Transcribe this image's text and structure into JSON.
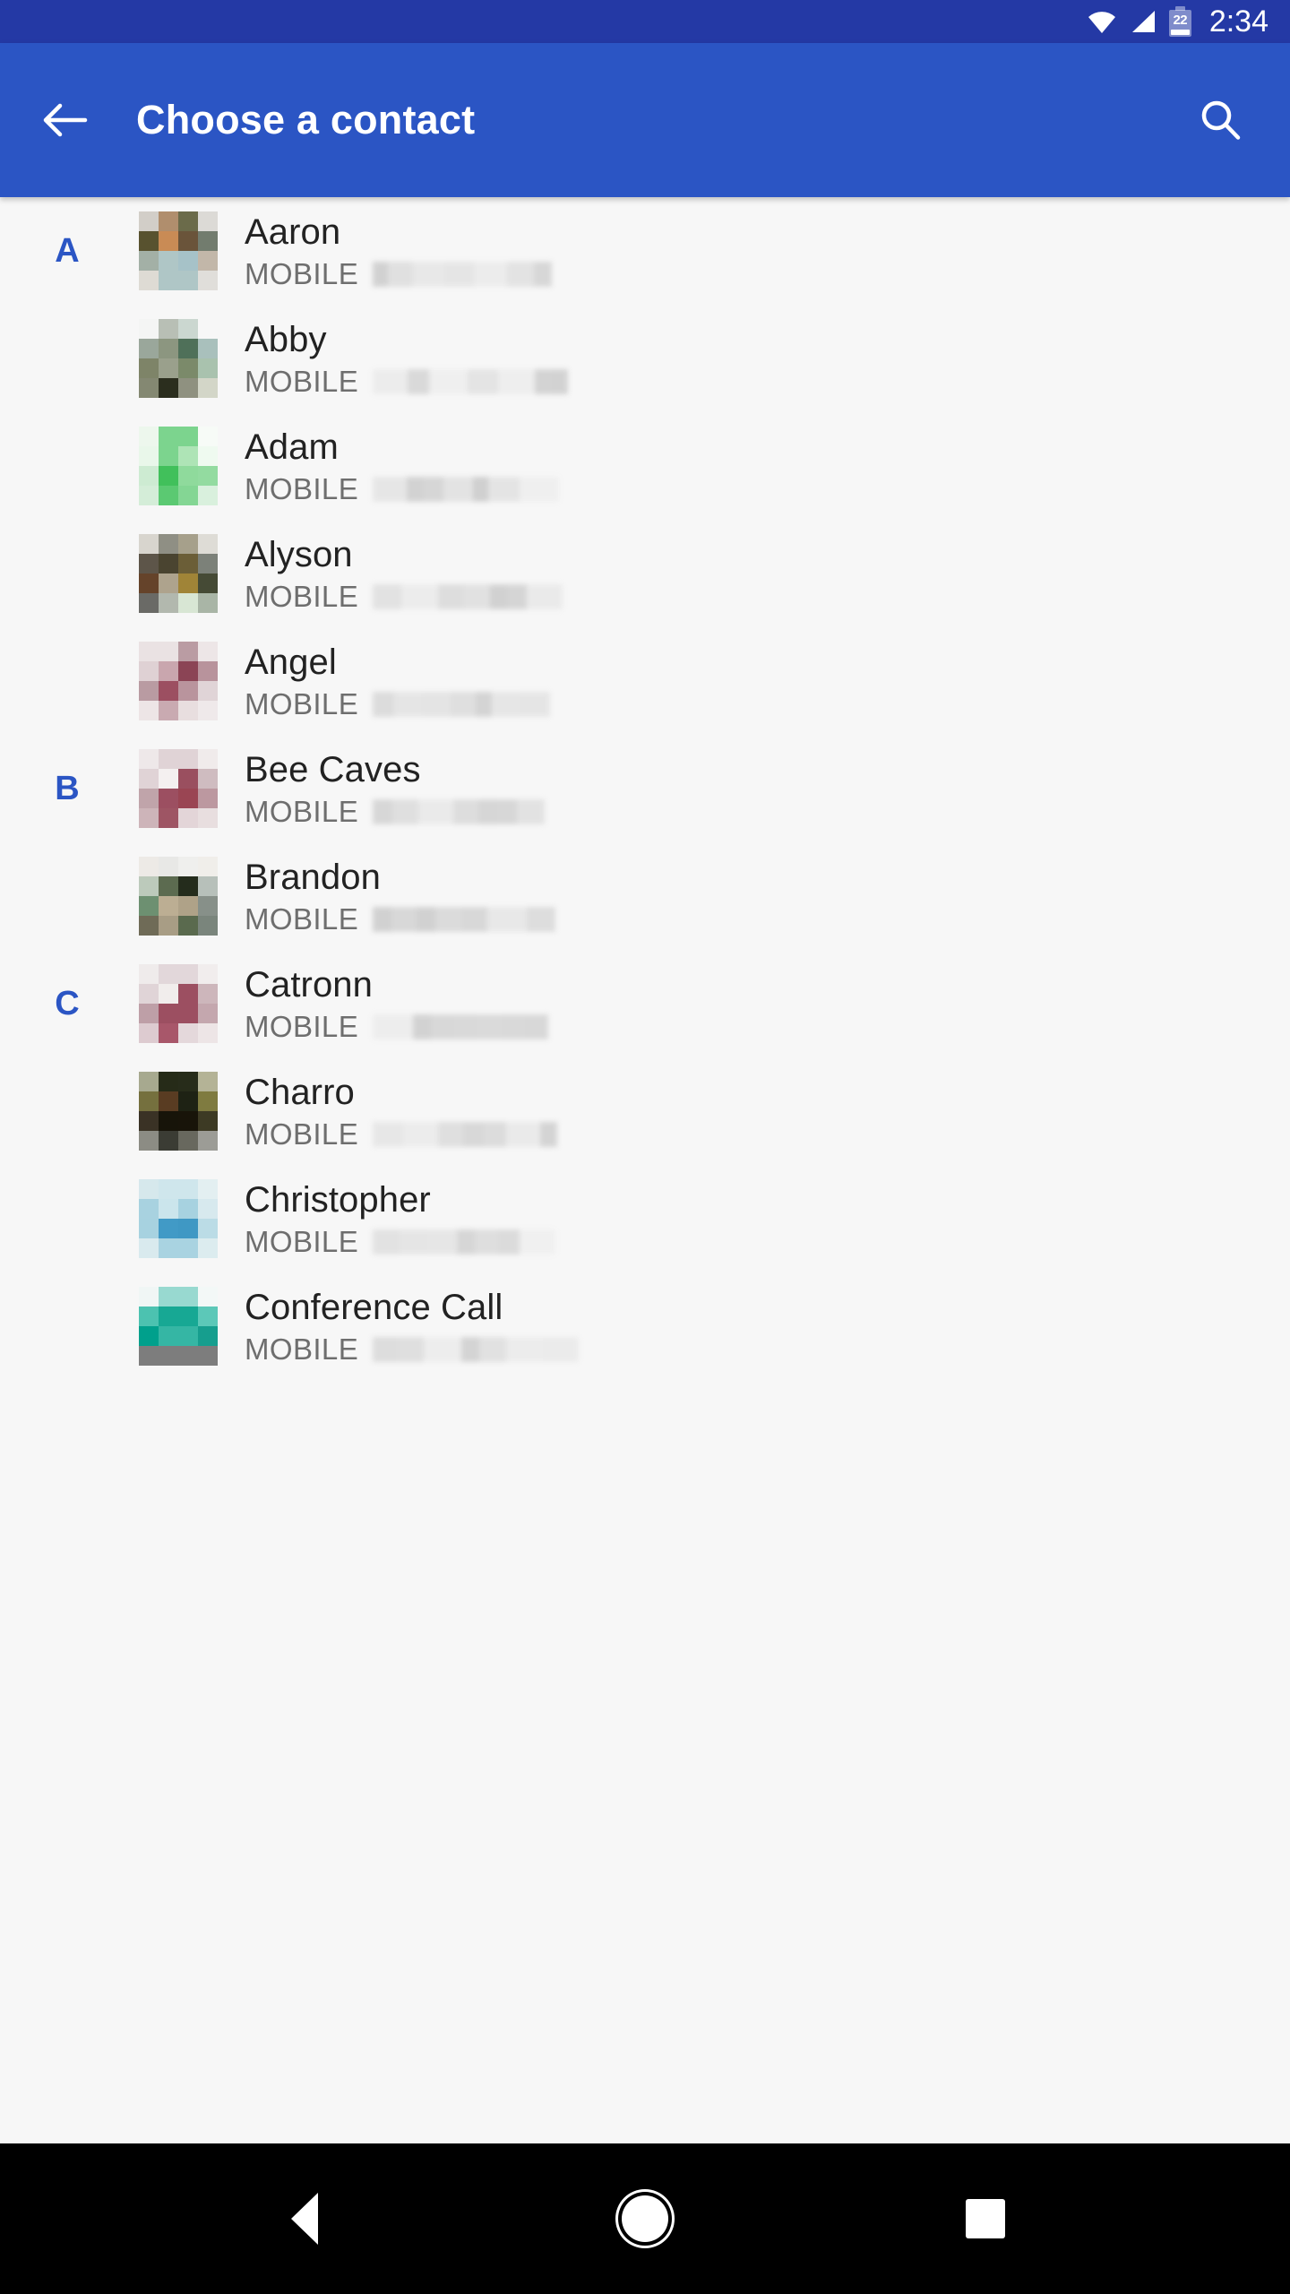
{
  "status_bar": {
    "time": "2:34",
    "battery_level": "22",
    "icons": [
      "wifi-icon",
      "cellular-signal-icon",
      "battery-icon"
    ]
  },
  "app_bar": {
    "title": "Choose a contact",
    "back_icon": "back-arrow-icon",
    "search_icon": "search-icon",
    "background_color": "#2B55C4"
  },
  "theme": {
    "accent": "#2B55C4",
    "status_bar_bg": "#2439A5",
    "list_bg": "#F7F7F7",
    "name_color": "#222222",
    "label_color": "#6E6E6E"
  },
  "contacts": [
    {
      "section": "A",
      "name": "Aaron",
      "phone_label": "MOBILE",
      "phone_redacted": true,
      "redact_width": 200,
      "avatar_colors": [
        "#D2CEC8",
        "#B08E6D",
        "#6B6B4A",
        "#DCDAD6",
        "#58522F",
        "#C98B55",
        "#6A543A",
        "#727C6E",
        "#A3B0A6",
        "#AFC6C6",
        "#A6C2C8",
        "#C2B7A9",
        "#DEDBD4",
        "#AFC6C6",
        "#AFC6C6",
        "#E0DEDA"
      ]
    },
    {
      "section": "",
      "name": "Abby",
      "phone_label": "MOBILE",
      "phone_redacted": true,
      "redact_width": 218,
      "avatar_colors": [
        "#F4F5F4",
        "#B8BFB5",
        "#CBD7D0",
        "#F7F7F7",
        "#9AA79B",
        "#8C9680",
        "#4F7059",
        "#A9C0BC",
        "#7E8468",
        "#9AA08C",
        "#7B8A6A",
        "#A9C2AE",
        "#848872",
        "#2B2E1E",
        "#8F9180",
        "#D3D6C8"
      ]
    },
    {
      "section": "",
      "name": "Adam",
      "phone_label": "MOBILE",
      "phone_redacted": true,
      "redact_width": 208,
      "avatar_colors": [
        "#EDF7ED",
        "#7CD48E",
        "#7CD48E",
        "#F7FBF7",
        "#E9F7EA",
        "#7CD48E",
        "#AEE4B6",
        "#EFFAF0",
        "#CDEBD2",
        "#41C05B",
        "#8FDA9C",
        "#93DBA0",
        "#D4EDD8",
        "#5BC972",
        "#84D694",
        "#D9F0DD"
      ]
    },
    {
      "section": "",
      "name": "Alyson",
      "phone_label": "MOBILE",
      "phone_redacted": true,
      "redact_width": 212,
      "avatar_colors": [
        "#D8D5CE",
        "#8F8F84",
        "#A6A08B",
        "#DEDCD6",
        "#5D5549",
        "#4A4430",
        "#6B5E37",
        "#7C8179",
        "#65432A",
        "#AEA38D",
        "#A08437",
        "#454A35",
        "#6A6A66",
        "#B2B8AE",
        "#D8E6D4",
        "#A9B5A6"
      ]
    },
    {
      "section": "",
      "name": "Angel",
      "phone_label": "MOBILE",
      "phone_redacted": true,
      "redact_width": 198,
      "avatar_colors": [
        "#EAE2E3",
        "#EAE2E3",
        "#BA9CA3",
        "#EDE6E7",
        "#DFD1D4",
        "#C9A6AE",
        "#8B4455",
        "#B8939C",
        "#B99BA2",
        "#9C4F61",
        "#B9949D",
        "#E0D4D7",
        "#EDE5E6",
        "#C9AAB1",
        "#E8DEDF",
        "#EFE9EA"
      ]
    },
    {
      "section": "B",
      "name": "Bee Caves",
      "phone_label": "MOBILE",
      "phone_redacted": true,
      "redact_width": 192,
      "avatar_colors": [
        "#EEE8E9",
        "#E0D3D6",
        "#E0D3D6",
        "#F0EBEB",
        "#E0D3D6",
        "#F4F0F0",
        "#9A4F5F",
        "#CFBCC0",
        "#C0A4AA",
        "#9C4F61",
        "#9A4553",
        "#BC98A0",
        "#CDB4B9",
        "#9E5564",
        "#E3D5D8",
        "#E8DEDF"
      ]
    },
    {
      "section": "",
      "name": "Brandon",
      "phone_label": "MOBILE",
      "phone_redacted": true,
      "redact_width": 204,
      "avatar_colors": [
        "#EDEAE6",
        "#E8E8E6",
        "#EFEFED",
        "#F0EEEA",
        "#BCCABB",
        "#5C6B50",
        "#242C1C",
        "#B7C0BA",
        "#6D9071",
        "#BCAE93",
        "#AFA288",
        "#879089",
        "#6F6B57",
        "#A89D85",
        "#5A6A4E",
        "#7A857C"
      ]
    },
    {
      "section": "C",
      "name": "Catronn",
      "phone_label": "MOBILE",
      "phone_redacted": true,
      "redact_width": 196,
      "avatar_colors": [
        "#EFEBEB",
        "#E2D7DA",
        "#E2D7DA",
        "#F1EDED",
        "#E0D4D7",
        "#F1EDEC",
        "#9C4F61",
        "#CDB6BB",
        "#BE9FA7",
        "#9C4F61",
        "#9C4F61",
        "#C4A7AE",
        "#DDCBD0",
        "#A8576A",
        "#E4D8DB",
        "#EDE5E6"
      ]
    },
    {
      "section": "",
      "name": "Charro",
      "phone_label": "MOBILE",
      "phone_redacted": true,
      "redact_width": 206,
      "avatar_colors": [
        "#A7A98F",
        "#262B18",
        "#272C1A",
        "#B4B396",
        "#75703E",
        "#593C22",
        "#1E2214",
        "#7F7B40",
        "#3A3225",
        "#171409",
        "#181409",
        "#3D3A24",
        "#8C8C84",
        "#3B3C34",
        "#68685E",
        "#9C9C96"
      ]
    },
    {
      "section": "",
      "name": "Christopher",
      "phone_label": "MOBILE",
      "phone_redacted": true,
      "redact_width": 204,
      "avatar_colors": [
        "#D6E8EC",
        "#CFE6EC",
        "#CFE6EC",
        "#E3EFF1",
        "#A8D2E0",
        "#CBE5EC",
        "#A7D2E0",
        "#D7E9EE",
        "#A7D2E0",
        "#419AC6",
        "#3F98C4",
        "#BBDCE6",
        "#D9EAEE",
        "#A9D3E1",
        "#A9D3E1",
        "#DCECEF"
      ]
    },
    {
      "section": "",
      "name": "Conference Call",
      "phone_label": "MOBILE",
      "phone_redacted": true,
      "redact_width": 230,
      "avatar_colors": [
        "#F0F6F5",
        "#98D9D0",
        "#98D9D0",
        "#F3F8F7",
        "#4CC2B0",
        "#17A894",
        "#17A894",
        "#5CC8B8",
        "#00A08C",
        "#35B6A4",
        "#35B6A4",
        "#169E8E",
        "#7D7D7D",
        "#7D7D7D",
        "#7D7D7D",
        "#7D7D7D"
      ]
    }
  ],
  "nav_bar": {
    "back_icon": "nav-back-triangle-icon",
    "home_icon": "nav-home-circle-icon",
    "recents_icon": "nav-recents-square-icon"
  }
}
